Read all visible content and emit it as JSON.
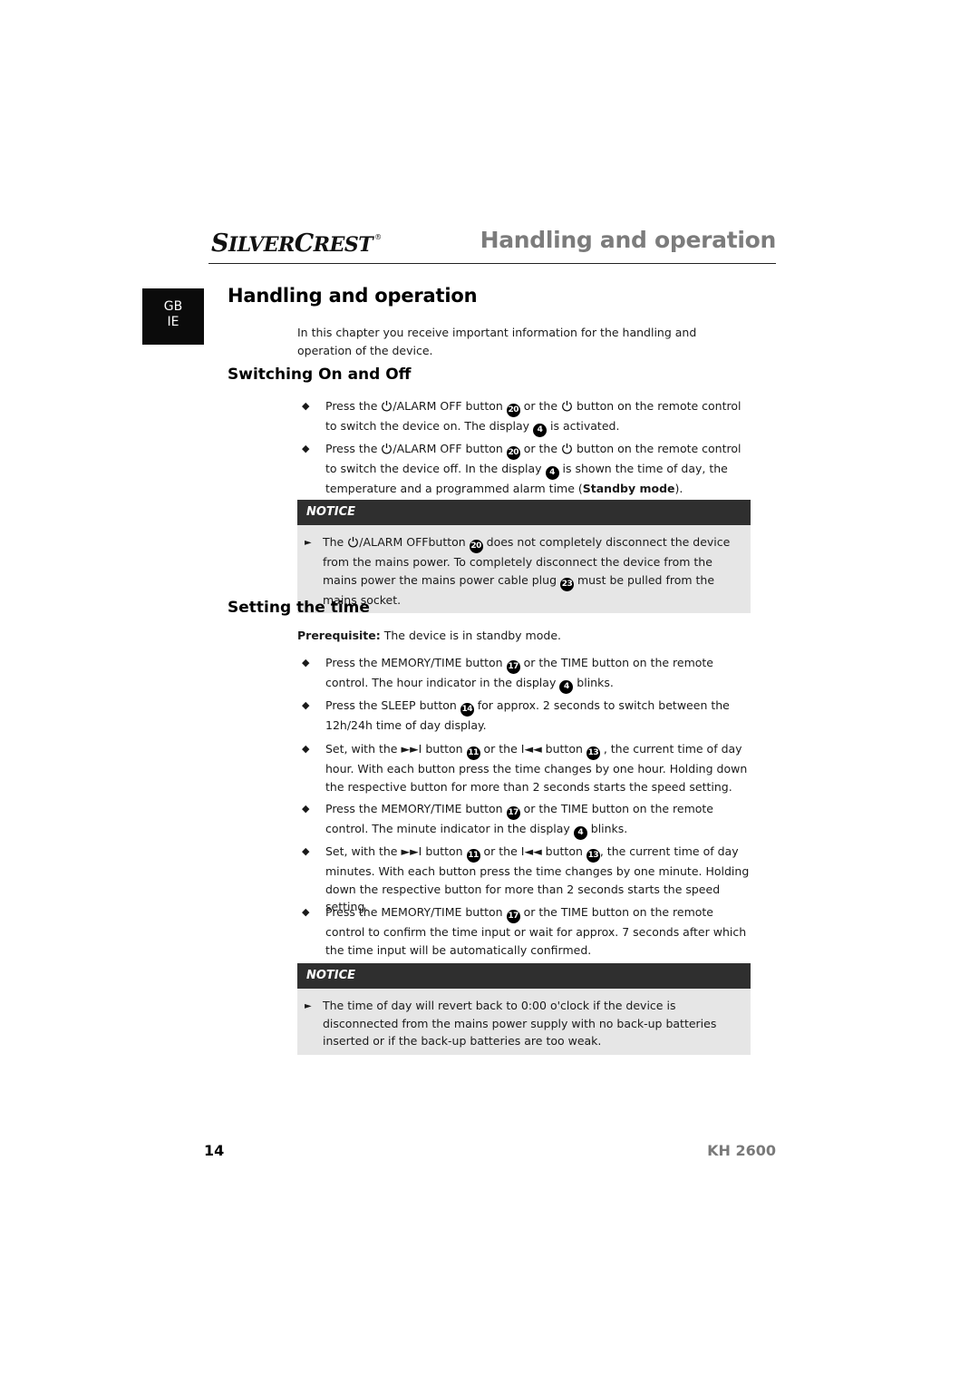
{
  "header": {
    "brand_first": "S",
    "brand_rest1": "ILVER",
    "brand_second": "C",
    "brand_rest2": "REST",
    "reg": "®",
    "section_title": "Handling and operation"
  },
  "lang_tab": {
    "line1": "GB",
    "line2": "IE"
  },
  "chapter": {
    "title": "Handling and operation",
    "intro": "In this chapter you receive important information for the handling and operation of the device."
  },
  "switching": {
    "title": "Switching On and Off",
    "bullets": [
      {
        "a": "Press the ",
        "b": "/ALARM OFF button ",
        "n1": "20",
        "c": " or the ",
        "d": " button on the remote control to switch the device on. The display ",
        "n2": "4",
        "e": " is activated."
      },
      {
        "a": "Press the ",
        "b": "/ALARM OFF button ",
        "n1": "20",
        "c": " or the ",
        "d": " button on the remote control to switch the device off. In the display ",
        "n2": "4",
        "e": " is shown the time of day, the temperature and a programmed alarm time (",
        "bold": "Standby mode",
        "f": ")."
      }
    ],
    "notice": {
      "label": "NOTICE",
      "a": "The ",
      "b": "/ALARM OFFbutton ",
      "n1": "20",
      "c": " does not completely disconnect the device from the mains power. To completely disconnect the device from the mains power the mains power cable plug ",
      "n2": "23",
      "d": " must be pulled from the mains socket."
    }
  },
  "setting_time": {
    "title": "Setting the time",
    "prereq_label": "Prerequisite:",
    "prereq_text": " The device is in standby mode.",
    "bullets": [
      {
        "a": "Press the MEMORY/TIME button ",
        "n1": "17",
        "b": " or the TIME button on the remote control. The hour indicator in the display ",
        "n2": "4",
        "c": " blinks."
      },
      {
        "a": "Press the SLEEP button ",
        "n1": "14",
        "b": " for approx. 2 seconds to switch between the 12h/24h time of day display."
      },
      {
        "a": "Set, with the ►►I button ",
        "n1": "11",
        "b": " or the I◄◄ button ",
        "n2": "13",
        "c": " , the current time of day hour. With each button press the time changes by one hour. Holding down the respective button for more than 2 seconds starts the speed setting."
      },
      {
        "a": "Press the MEMORY/TIME button ",
        "n1": "17",
        "b": " or the TIME button on the remote control. The minute indicator in the display ",
        "n2": "4",
        "c": " blinks."
      },
      {
        "a": "Set, with the ►►I button ",
        "n1": "11",
        "b": " or the I◄◄ button ",
        "n2": "13",
        "c": ", the current time of day minutes. With each button press the time changes by one minute. Holding down the respective button for more than 2 seconds starts the speed setting."
      },
      {
        "a": "Press the MEMORY/TIME button ",
        "n1": "17",
        "b": " or the TIME button on the remote control to confirm the time input or wait for approx. 7 seconds after which the time input will be automatically confirmed."
      }
    ],
    "notice": {
      "label": "NOTICE",
      "text": "The time of day will revert back to 0:00 o'clock if the device is disconnected from the mains power supply with no back-up batteries inserted or if the back-up batteries are too weak."
    }
  },
  "footer": {
    "page_number": "14",
    "model": "KH 2600"
  },
  "icons": {
    "bullet": "diamond-bullet-icon",
    "power": "power-icon",
    "notice_arrow": "triangle-right-icon"
  }
}
